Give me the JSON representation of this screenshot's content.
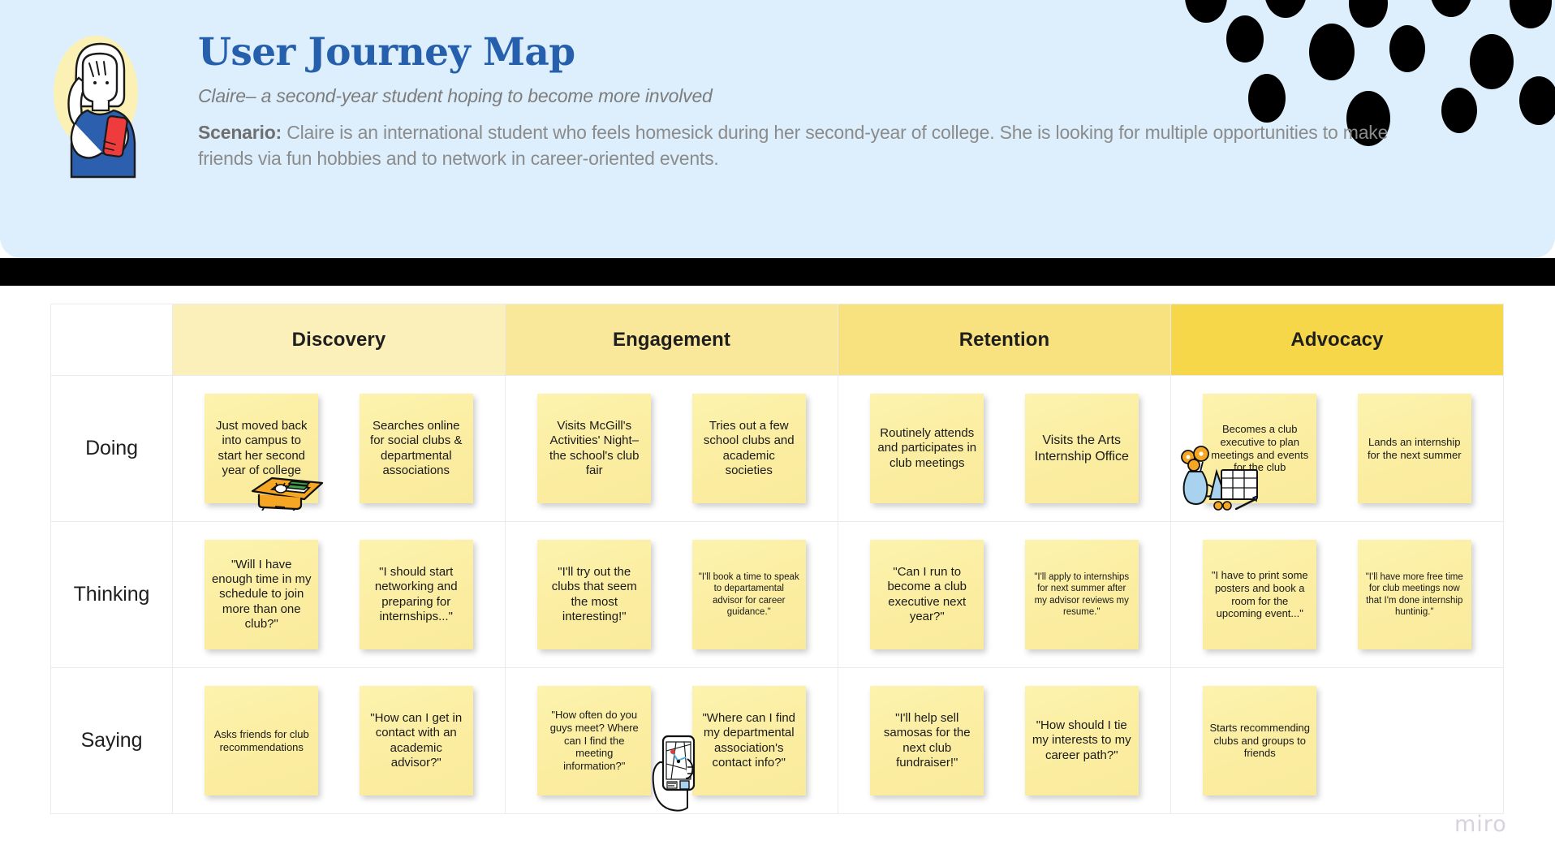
{
  "header": {
    "title": "User Journey Map",
    "persona": "Claire– a second-year student hoping to become more involved",
    "scenario_label": "Scenario:",
    "scenario_text": " Claire is an international student who feels homesick during her second-year of college. She is looking for multiple opportunities to make friends via fun hobbies and to network in career-oriented events.",
    "background_color": "#ddeffc",
    "title_color": "#2660ad"
  },
  "watermark": "miro",
  "grid": {
    "corner_label": "",
    "stages": [
      {
        "label": "Discovery",
        "color": "#fbf0b9"
      },
      {
        "label": "Engagement",
        "color": "#f9e79a"
      },
      {
        "label": "Retention",
        "color": "#f8e17f"
      },
      {
        "label": "Advocacy",
        "color": "#f6d74a"
      }
    ],
    "rows": [
      {
        "label": "Doing",
        "cells": [
          {
            "notes": [
              {
                "text": "Just moved back into campus to start her second year of college",
                "size": "md"
              },
              {
                "text": "Searches online for social clubs & departmental associations",
                "size": "md"
              }
            ],
            "decor": "suitcase-illustration"
          },
          {
            "notes": [
              {
                "text": "Visits McGill's Activities' Night– the school's club fair",
                "size": "md"
              },
              {
                "text": "Tries out a few school clubs and academic societies",
                "size": "md"
              }
            ],
            "decor": null
          },
          {
            "notes": [
              {
                "text": "Routinely attends and participates in club meetings",
                "size": "md"
              },
              {
                "text": "Visits the Arts Internship Office",
                "size": "lg"
              }
            ],
            "decor": null
          },
          {
            "notes": [
              {
                "text": "Becomes a club executive to plan meetings and events for the club",
                "size": "sm"
              },
              {
                "text": "Lands an internship for the next summer",
                "size": "sm"
              }
            ],
            "decor": "flowers-calendar-illustration"
          }
        ]
      },
      {
        "label": "Thinking",
        "cells": [
          {
            "notes": [
              {
                "text": "\"Will I have enough time in my schedule to join more than one club?\"",
                "size": "md"
              },
              {
                "text": "\"I should start networking and preparing for internships...\"",
                "size": "md"
              }
            ],
            "decor": null
          },
          {
            "notes": [
              {
                "text": "\"I'll try out the clubs that seem the most interesting!\"",
                "size": "md"
              },
              {
                "text": "\"I'll book a time to speak to departamental advisor for career guidance.\"",
                "size": "xs"
              }
            ],
            "decor": null
          },
          {
            "notes": [
              {
                "text": "\"Can I run to become a club executive next year?\"",
                "size": "md"
              },
              {
                "text": "\"I'll apply to internships for next summer after my advisor reviews my resume.\"",
                "size": "xs"
              }
            ],
            "decor": null
          },
          {
            "notes": [
              {
                "text": "\"I have to print some posters and book a room for the upcoming event...\"",
                "size": "sm"
              },
              {
                "text": "\"I'll have more free time for club meetings now that I'm done internship huntinig.\"",
                "size": "xs"
              }
            ],
            "decor": null
          }
        ]
      },
      {
        "label": "Saying",
        "cells": [
          {
            "notes": [
              {
                "text": "Asks friends for club recommendations",
                "size": "sm"
              },
              {
                "text": "\"How can I get in contact with an academic advisor?\"",
                "size": "md"
              }
            ],
            "decor": null
          },
          {
            "notes": [
              {
                "text": "\"How often do you guys meet? Where can I find the meeting information?\"",
                "size": "sm"
              },
              {
                "text": "\"Where can I find my departmental association's contact info?\"",
                "size": "md"
              }
            ],
            "decor": "phone-map-illustration"
          },
          {
            "notes": [
              {
                "text": "\"I'll help sell samosas for the next club fundraiser!\"",
                "size": "md"
              },
              {
                "text": "\"How should I tie my interests to my career path?\"",
                "size": "md"
              }
            ],
            "decor": null
          },
          {
            "notes": [
              {
                "text": "Starts recommending clubs and groups to friends",
                "size": "sm"
              },
              {
                "text": "",
                "size": "sm"
              }
            ],
            "decor": null
          }
        ]
      }
    ]
  }
}
